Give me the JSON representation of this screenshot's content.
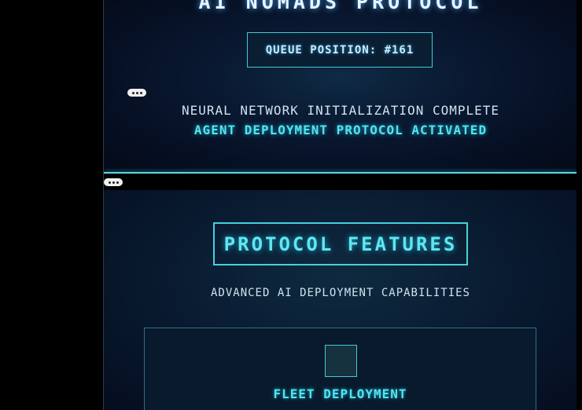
{
  "hero": {
    "title": "AI NOMADS PROTOCOL",
    "queue_label": "QUEUE POSITION: #161",
    "status_line_1": "NEURAL NETWORK INITIALIZATION COMPLETE",
    "status_line_2": "AGENT DEPLOYMENT PROTOCOL ACTIVATED"
  },
  "features": {
    "title": "PROTOCOL FEATURES",
    "subtitle": "ADVANCED AI DEPLOYMENT CAPABILITIES",
    "cards": [
      {
        "icon": "square-icon",
        "title": "FLEET DEPLOYMENT"
      }
    ]
  },
  "controls": {
    "more_icon_1": "more-options-icon",
    "more_icon_2": "more-options-icon"
  },
  "colors": {
    "accent_cyan": "#53e3f0",
    "border_cyan": "#46d0de",
    "background_dark": "#050b18",
    "text_light": "#cfe2f0"
  }
}
